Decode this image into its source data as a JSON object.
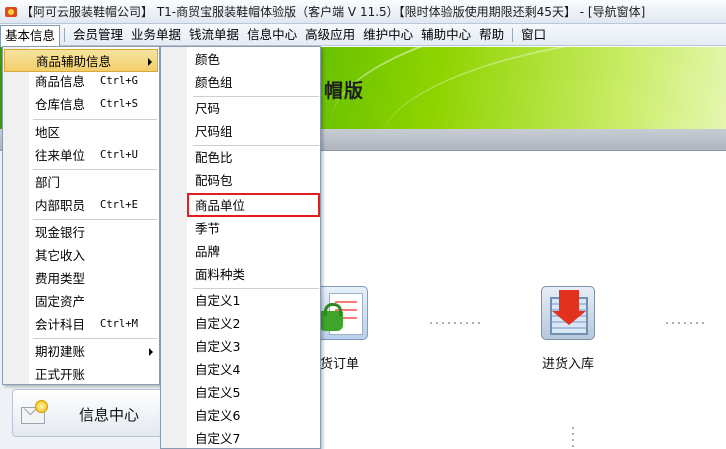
{
  "window": {
    "title": "【阿可云服装鞋帽公司】 T1-商贸宝服装鞋帽体验版（客户端 V 11.5）【限时体验版使用期限还剩45天】 - [导航窗体]"
  },
  "menubar": {
    "items": [
      "基本信息",
      "会员管理",
      "业务单据",
      "钱流单据",
      "信息中心",
      "高级应用",
      "维护中心",
      "辅助中心",
      "帮助",
      "窗口"
    ]
  },
  "banner": {
    "title": "帽版"
  },
  "left_panel": {
    "info_center_label": "信息中心"
  },
  "modules": [
    {
      "label": "货订单",
      "icon": "order-basket-icon"
    },
    {
      "label": "进货入库",
      "icon": "stock-in-arrow-icon"
    }
  ],
  "menu_basic": {
    "items": [
      {
        "label": "商品辅助信息",
        "shortcut": ""
      },
      {
        "label": "商品信息",
        "shortcut": "Ctrl+G"
      },
      {
        "label": "仓库信息",
        "shortcut": "Ctrl+S"
      },
      {
        "label": "地区",
        "shortcut": ""
      },
      {
        "label": "往来单位",
        "shortcut": "Ctrl+U"
      },
      {
        "label": "部门",
        "shortcut": ""
      },
      {
        "label": "内部职员",
        "shortcut": "Ctrl+E"
      },
      {
        "label": "现金银行",
        "shortcut": ""
      },
      {
        "label": "其它收入",
        "shortcut": ""
      },
      {
        "label": "费用类型",
        "shortcut": ""
      },
      {
        "label": "固定资产",
        "shortcut": ""
      },
      {
        "label": "会计科目",
        "shortcut": "Ctrl+M"
      },
      {
        "label": "期初建账",
        "shortcut": ""
      },
      {
        "label": "正式开账",
        "shortcut": ""
      }
    ]
  },
  "menu_aux": {
    "items": [
      {
        "label": "颜色"
      },
      {
        "label": "颜色组"
      },
      {
        "label": "尺码"
      },
      {
        "label": "尺码组"
      },
      {
        "label": "配色比"
      },
      {
        "label": "配码包"
      },
      {
        "label": "商品单位"
      },
      {
        "label": "季节"
      },
      {
        "label": "品牌"
      },
      {
        "label": "面料种类"
      },
      {
        "label": "自定义1"
      },
      {
        "label": "自定义2"
      },
      {
        "label": "自定义3"
      },
      {
        "label": "自定义4"
      },
      {
        "label": "自定义5"
      },
      {
        "label": "自定义6"
      },
      {
        "label": "自定义7"
      }
    ],
    "highlighted": "商品单位"
  },
  "colors": {
    "highlight": "#f2cf6b",
    "annotation_box": "#e02020",
    "banner_green": "#55b800"
  }
}
